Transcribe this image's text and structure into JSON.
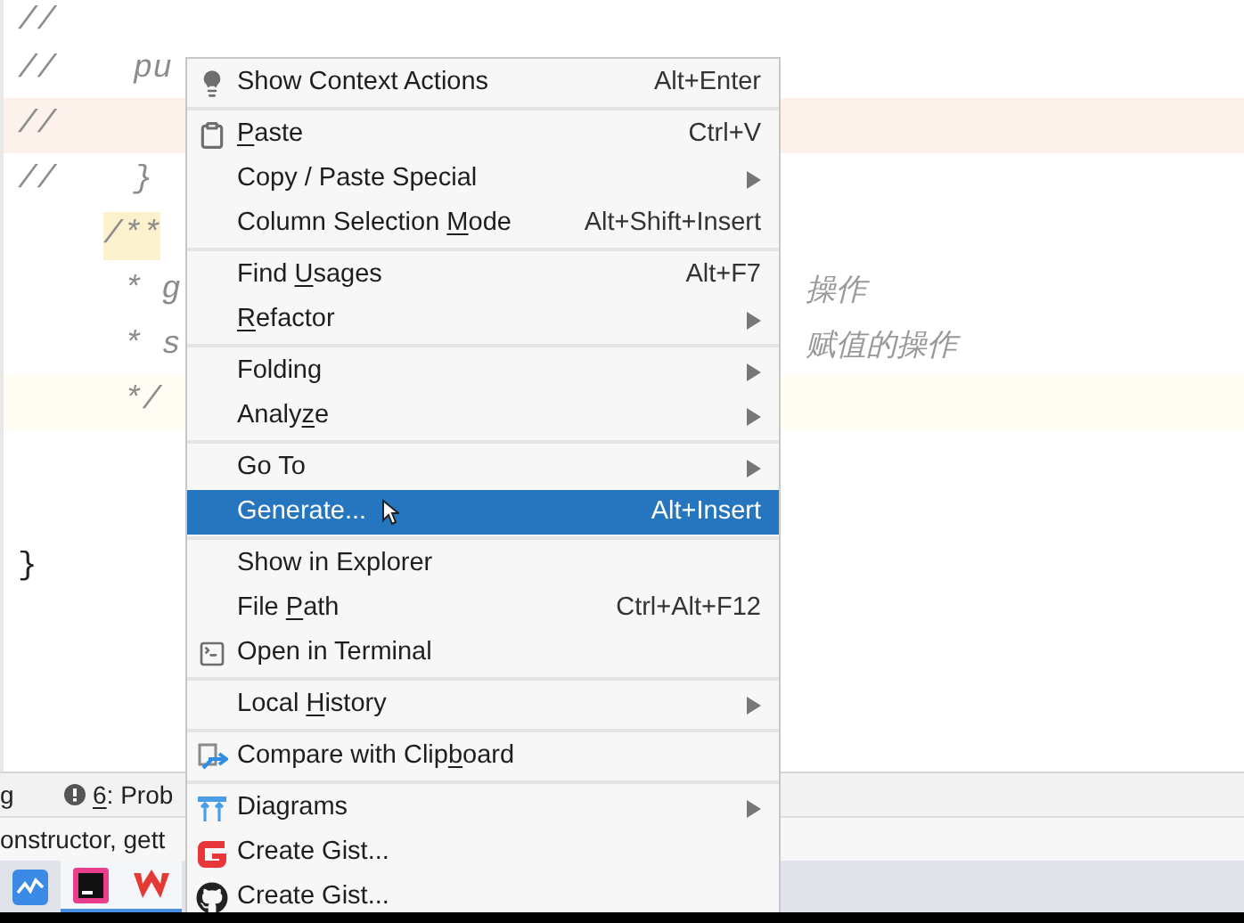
{
  "editor": {
    "code_lines": [
      {
        "text": "//",
        "kind": "comment"
      },
      {
        "text": "//    pu",
        "kind": "comment"
      },
      {
        "text": "//",
        "kind": "comment",
        "color": "#fdf1ec"
      },
      {
        "text": "//    }",
        "kind": "comment"
      },
      {
        "text": "/**",
        "kind": "doc_open",
        "marked": true
      },
      {
        "text": "* g",
        "kind": "doc",
        "tail": "操作"
      },
      {
        "text": "* s",
        "kind": "doc",
        "tail": "赋值的操作"
      },
      {
        "text": "*/",
        "kind": "doc",
        "color": "#fffdf3"
      }
    ],
    "closing_brace": "}"
  },
  "context_menu": {
    "groups": [
      [
        {
          "label": "Show Context Actions",
          "kind": "bulb",
          "shortcut": "Alt+Enter",
          "submenu": false,
          "selected": false
        }
      ],
      [
        {
          "mnemonic": "P",
          "after": "aste",
          "kind": "clipboard",
          "shortcut": "Ctrl+V",
          "submenu": false,
          "selected": false
        },
        {
          "label": "Copy / Paste Special",
          "kind": "plain",
          "submenu": true,
          "selected": false
        },
        {
          "label": "Column Selection ",
          "mnemonic": "M",
          "after": "ode",
          "kind": "plain",
          "shortcut": "Alt+Shift+Insert",
          "submenu": false,
          "selected": false
        }
      ],
      [
        {
          "label": "Find ",
          "mnemonic": "U",
          "after": "sages",
          "kind": "plain",
          "shortcut": "Alt+F7",
          "submenu": false,
          "selected": false
        },
        {
          "mnemonic": "R",
          "after": "efactor",
          "kind": "plain",
          "submenu": true,
          "selected": false
        }
      ],
      [
        {
          "label": "Folding",
          "kind": "plain",
          "submenu": true,
          "selected": false
        },
        {
          "label": "Analy",
          "mnemonic": "z",
          "after": "e",
          "kind": "plain",
          "submenu": true,
          "selected": false
        }
      ],
      [
        {
          "label": "Go To",
          "kind": "plain",
          "submenu": true,
          "selected": false
        },
        {
          "label": "Generate...",
          "kind": "plain",
          "shortcut": "Alt+Insert",
          "submenu": false,
          "selected": true
        }
      ],
      [
        {
          "label": "Show in Explorer",
          "kind": "plain",
          "submenu": false,
          "selected": false
        },
        {
          "label": "File ",
          "mnemonic": "P",
          "after": "ath",
          "kind": "plain",
          "shortcut": "Ctrl+Alt+F12",
          "submenu": false,
          "selected": false
        },
        {
          "label": "Open in Terminal",
          "kind": "terminal",
          "submenu": false,
          "selected": false
        }
      ],
      [
        {
          "label": "Local ",
          "mnemonic": "H",
          "after": "istory",
          "kind": "plain",
          "submenu": true,
          "selected": false
        }
      ],
      [
        {
          "label": "Compare with Clip",
          "mnemonic": "b",
          "after": "oard",
          "kind": "compare",
          "submenu": false,
          "selected": false
        }
      ],
      [
        {
          "label": "Diagrams",
          "kind": "diagram",
          "submenu": true,
          "selected": false
        },
        {
          "label": "Create Gist...",
          "kind": "gitee",
          "submenu": false,
          "selected": false
        },
        {
          "label": "Create Gist...",
          "kind": "github",
          "submenu": false,
          "selected": false
        }
      ]
    ]
  },
  "tool_window_bar": {
    "left_text": "g",
    "problems_tab": {
      "mnemonic": "6",
      "after": ": Prob"
    }
  },
  "status_bar": {
    "text": "onstructor, gett"
  },
  "taskbar": {
    "apps": [
      {
        "kind": "monitor",
        "selected": false
      },
      {
        "kind": "ide",
        "selected": true
      },
      {
        "kind": "office",
        "selected": true
      }
    ]
  }
}
